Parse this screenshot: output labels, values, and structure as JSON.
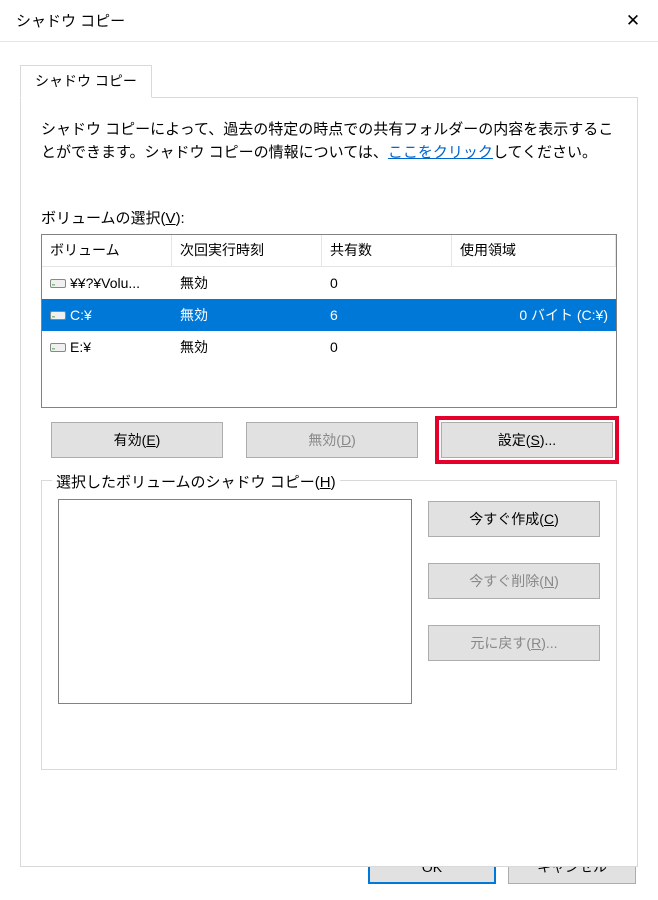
{
  "window": {
    "title": "シャドウ コピー"
  },
  "tab": {
    "label": "シャドウ コピー"
  },
  "intro": {
    "text_before_link": "シャドウ コピーによって、過去の特定の時点での共有フォルダーの内容を表示することができます。シャドウ コピーの情報については、",
    "link_text": "ここをクリック",
    "text_after_link": "してください。"
  },
  "volume_select": {
    "label_pre": "ボリュームの選択(",
    "label_key": "V",
    "label_post": "):"
  },
  "columns": {
    "volume": "ボリューム",
    "next_run": "次回実行時刻",
    "shares": "共有数",
    "used": "使用領域"
  },
  "rows": [
    {
      "volume": "¥¥?¥Volu...",
      "next_run": "無効",
      "shares": "0",
      "used": ""
    },
    {
      "volume": "C:¥",
      "next_run": "無効",
      "shares": "6",
      "used": "0 バイト (C:¥)",
      "selected": true
    },
    {
      "volume": "E:¥",
      "next_run": "無効",
      "shares": "0",
      "used": ""
    }
  ],
  "buttons": {
    "enable_pre": "有効(",
    "enable_key": "E",
    "enable_post": ")",
    "disable_pre": "無効(",
    "disable_key": "D",
    "disable_post": ")",
    "settings_pre": "設定(",
    "settings_key": "S",
    "settings_post": ")..."
  },
  "fieldset": {
    "legend_pre": "選択したボリュームのシャドウ コピー(",
    "legend_key": "H",
    "legend_post": ")"
  },
  "side_buttons": {
    "create_pre": "今すぐ作成(",
    "create_key": "C",
    "create_post": ")",
    "delete_pre": "今すぐ削除(",
    "delete_key": "N",
    "delete_post": ")",
    "revert_pre": "元に戻す(",
    "revert_key": "R",
    "revert_post": ")..."
  },
  "footer": {
    "ok": "OK",
    "cancel": "キャンセル"
  }
}
